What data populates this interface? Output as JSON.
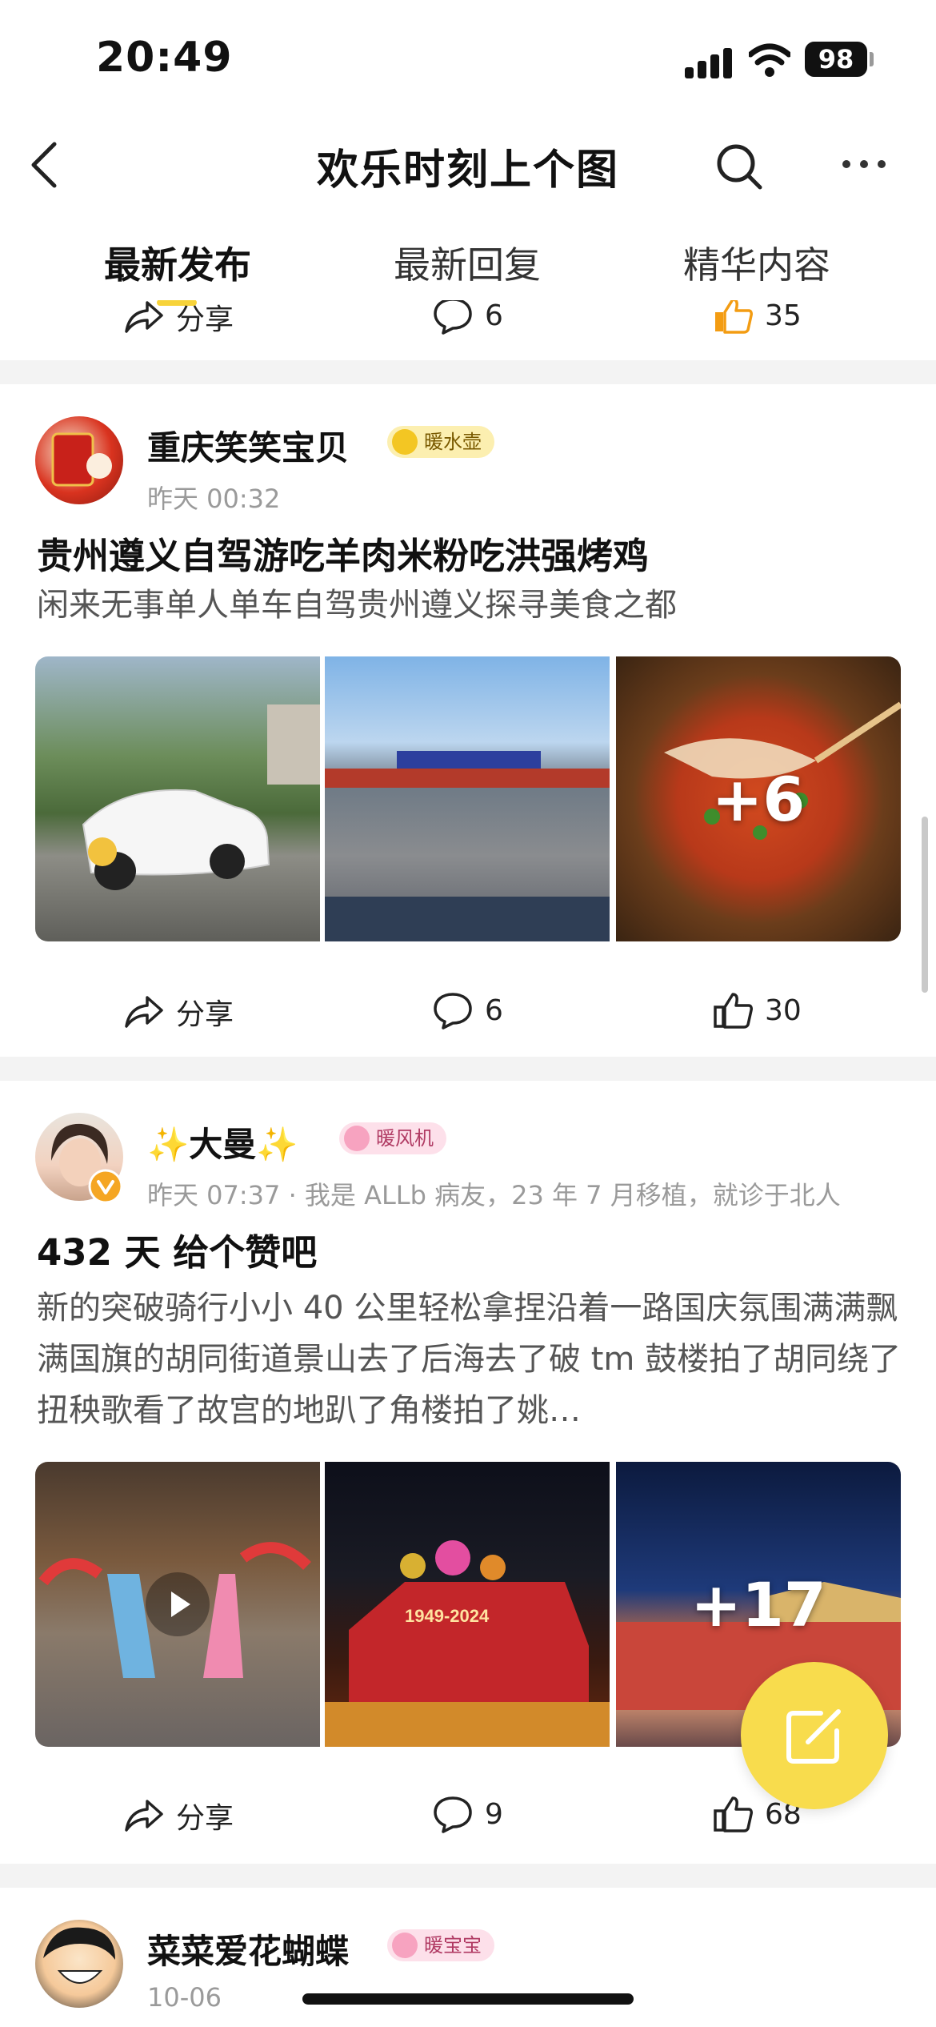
{
  "status_bar": {
    "time": "20:49",
    "battery": "98"
  },
  "header": {
    "title": "欢乐时刻上个图"
  },
  "tabs": [
    {
      "label": "最新发布",
      "active": true
    },
    {
      "label": "最新回复",
      "active": false
    },
    {
      "label": "精华内容",
      "active": false
    }
  ],
  "prev_post_actions": {
    "share": "分享",
    "comments": "6",
    "likes": "35"
  },
  "posts": [
    {
      "author": "重庆笑笑宝贝",
      "badge": "暖水壶",
      "meta": "昨天 00:32",
      "title": "贵州遵义自驾游吃羊肉米粉吃洪强烤鸡",
      "desc": "闲来无事单人单车自驾贵州遵义探寻美食之都",
      "more_images": "+6",
      "actions": {
        "share": "分享",
        "comments": "6",
        "likes": "30"
      }
    },
    {
      "author": "✨大曼✨",
      "badge": "暖风机",
      "meta": "昨天 07:37 · 我是 ALLb 病友，23 年 7 月移植，就诊于北人",
      "title": "432 天  给个赞吧",
      "desc": "新的突破骑行小小 40 公里轻松拿捏沿着一路国庆氛围满满飘满国旗的胡同街道景山去了后海去了破 tm 鼓楼拍了胡同绕了扭秧歌看了故宫的地趴了角楼拍了姚…",
      "image_caption": "1949-2024",
      "more_images": "+17",
      "actions": {
        "share": "分享",
        "comments": "9",
        "likes": "68"
      }
    },
    {
      "author": "菜菜爱花蝴蝶",
      "badge": "暖宝宝",
      "meta": "10-06"
    }
  ],
  "colors": {
    "accent": "#f8dc4d",
    "divider": "#f3f3f3",
    "liked": "#f39c12"
  },
  "icons": [
    "back-icon",
    "search-icon",
    "more-icon",
    "share-icon",
    "comment-icon",
    "like-icon",
    "compose-icon",
    "play-icon",
    "verified-icon"
  ]
}
